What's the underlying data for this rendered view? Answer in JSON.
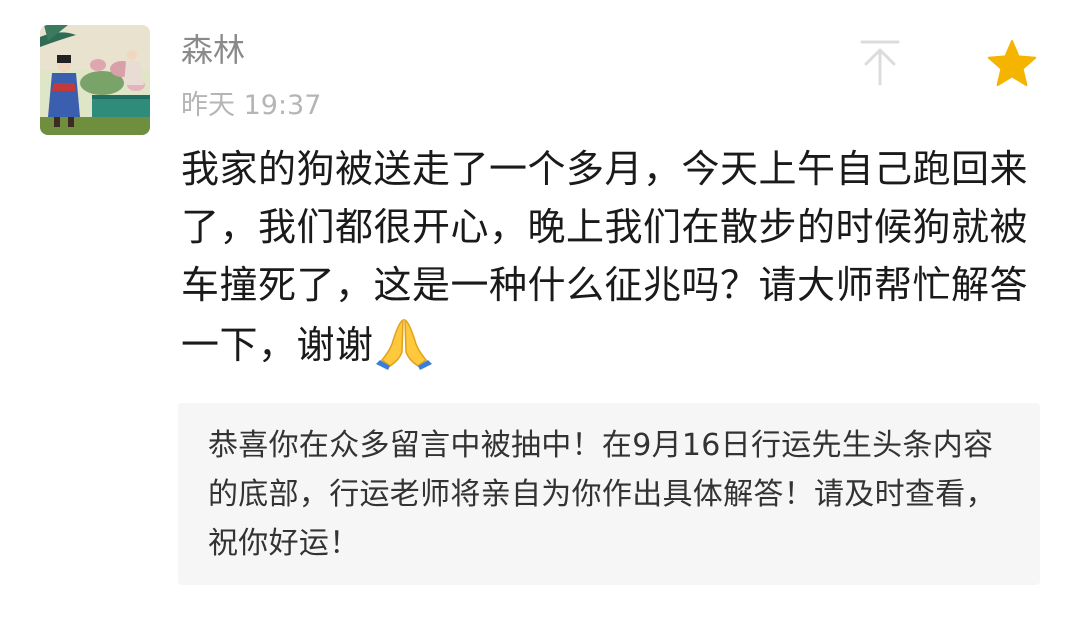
{
  "comment": {
    "author": "森林",
    "time": "昨天 19:37",
    "text": "我家的狗被送走了一个多月，今天上午自己跑回来了，我们都很开心，晚上我们在散步的时候狗就被车撞死了，这是一种什么征兆吗？请大师帮忙解答一下，谢谢",
    "emoji": "folded-hands-emoji",
    "avatar_icon": "painting-avatar",
    "pin_icon": "pin-to-top-icon",
    "star_icon": "star-icon",
    "star_color": "#f5b400"
  },
  "reply": {
    "text": "恭喜你在众多留言中被抽中！在9月16日行运先生头条内容的底部，行运老师将亲自为你作出具体解答！请及时查看，祝你好运！"
  }
}
